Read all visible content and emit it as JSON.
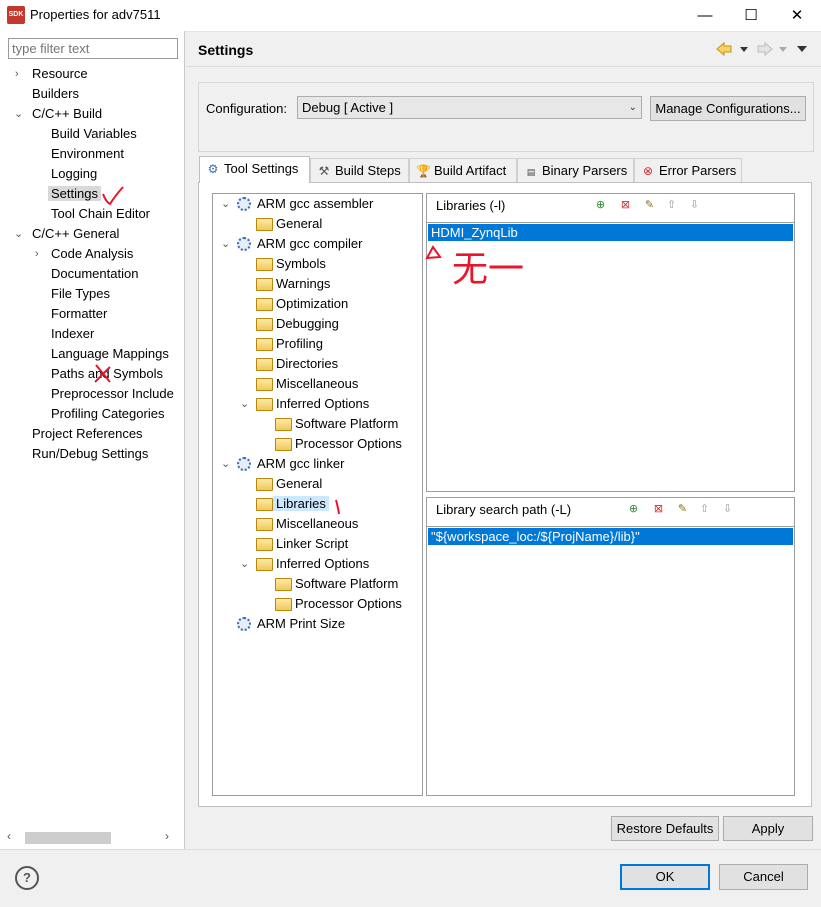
{
  "window": {
    "title": "Properties for adv7511",
    "app_icon_text": "SDK",
    "minimize": "—",
    "maximize": "☐",
    "close": "✕"
  },
  "filter": {
    "placeholder": "type filter text"
  },
  "nav": [
    {
      "label": "Resource",
      "expander": "›"
    },
    {
      "label": "Builders"
    },
    {
      "label": "C/C++ Build",
      "expander": "⌄"
    },
    {
      "label": "Build Variables"
    },
    {
      "label": "Environment"
    },
    {
      "label": "Logging"
    },
    {
      "label": "Settings",
      "selected": true
    },
    {
      "label": "Tool Chain Editor"
    },
    {
      "label": "C/C++ General",
      "expander": "⌄"
    },
    {
      "label": "Code Analysis",
      "expander": "›"
    },
    {
      "label": "Documentation"
    },
    {
      "label": "File Types"
    },
    {
      "label": "Formatter"
    },
    {
      "label": "Indexer"
    },
    {
      "label": "Language Mappings"
    },
    {
      "label": "Paths and Symbols"
    },
    {
      "label": "Preprocessor Include"
    },
    {
      "label": "Profiling Categories"
    },
    {
      "label": "Project References"
    },
    {
      "label": "Run/Debug Settings"
    }
  ],
  "header": {
    "title": "Settings"
  },
  "configuration": {
    "label": "Configuration:",
    "value": "Debug  [ Active ]",
    "manage_button": "Manage Configurations..."
  },
  "tabs": [
    {
      "label": "Tool Settings",
      "icon": "tool-settings-icon",
      "active": true
    },
    {
      "label": "Build Steps",
      "icon": "build-steps-icon"
    },
    {
      "label": "Build Artifact",
      "icon": "build-artifact-icon"
    },
    {
      "label": "Binary Parsers",
      "icon": "binary-parsers-icon"
    },
    {
      "label": "Error Parsers",
      "icon": "error-parsers-icon"
    }
  ],
  "tool_tree": [
    {
      "label": "ARM gcc assembler",
      "type": "tool"
    },
    {
      "label": "General",
      "type": "option"
    },
    {
      "label": "ARM gcc compiler",
      "type": "tool"
    },
    {
      "label": "Symbols",
      "type": "option"
    },
    {
      "label": "Warnings",
      "type": "option"
    },
    {
      "label": "Optimization",
      "type": "option"
    },
    {
      "label": "Debugging",
      "type": "option"
    },
    {
      "label": "Profiling",
      "type": "option"
    },
    {
      "label": "Directories",
      "type": "option"
    },
    {
      "label": "Miscellaneous",
      "type": "option"
    },
    {
      "label": "Inferred Options",
      "type": "option"
    },
    {
      "label": "Software Platform",
      "type": "option"
    },
    {
      "label": "Processor Options",
      "type": "option"
    },
    {
      "label": "ARM gcc linker",
      "type": "tool"
    },
    {
      "label": "General",
      "type": "option"
    },
    {
      "label": "Libraries",
      "type": "option",
      "selected": true
    },
    {
      "label": "Miscellaneous",
      "type": "option"
    },
    {
      "label": "Linker Script",
      "type": "option"
    },
    {
      "label": "Inferred Options",
      "type": "option"
    },
    {
      "label": "Software Platform",
      "type": "option"
    },
    {
      "label": "Processor Options",
      "type": "option"
    },
    {
      "label": "ARM Print Size",
      "type": "tool"
    }
  ],
  "libraries": {
    "title": "Libraries (-l)",
    "items": [
      "HDMI_ZynqLib"
    ]
  },
  "library_search_path": {
    "title": "Library search path (-L)",
    "items": [
      "\"${workspace_loc:/${ProjName}/lib}\""
    ]
  },
  "toolbar_icons": [
    "add-icon",
    "delete-icon",
    "edit-icon",
    "move-up-icon",
    "move-down-icon"
  ],
  "buttons": {
    "restore_defaults": "Restore Defaults",
    "apply": "Apply",
    "ok": "OK",
    "cancel": "Cancel",
    "help": "?"
  },
  "annotations": {
    "handwritten_note": "无一"
  },
  "colors": {
    "selection": "#0078d7",
    "annotation_red": "#e8152b"
  }
}
